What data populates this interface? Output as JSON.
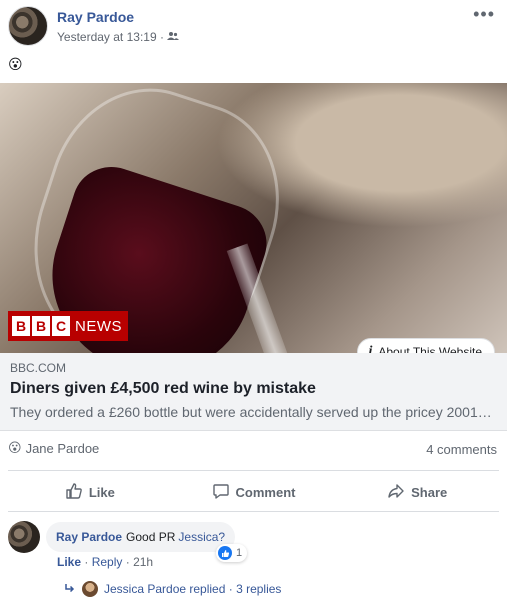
{
  "post": {
    "author": "Ray Pardoe",
    "timestamp": "Yesterday at 13:19 ·",
    "audience_icon": "friends-icon",
    "more_icon": "more-dots-icon",
    "more_label": "•••",
    "emoji": "😮"
  },
  "link": {
    "logo_letters": [
      "B",
      "B",
      "C"
    ],
    "logo_word": "NEWS",
    "about_button": "About This Website",
    "domain": "BBC.COM",
    "headline": "Diners given £4,500 red wine by mistake",
    "description": "They ordered a £260 bottle but were accidentally served up the pricey 2001…"
  },
  "engagement": {
    "reaction_emoji": "😮",
    "reactor": "Jane Pardoe",
    "comments_count": "4 comments"
  },
  "actions": {
    "like": "Like",
    "comment": "Comment",
    "share": "Share"
  },
  "comment": {
    "author": "Ray Pardoe",
    "text": "Good PR",
    "mention": "Jessica?",
    "like_link": "Like",
    "reply_link": "Reply",
    "age": "· 21h",
    "separator": "·",
    "like_count": "1",
    "replies_text": "Jessica Pardoe replied · 3 replies"
  },
  "colors": {
    "link_blue": "#385898",
    "like_blue": "#1877f2",
    "bbc_red": "#b80000",
    "muted": "#606770"
  }
}
